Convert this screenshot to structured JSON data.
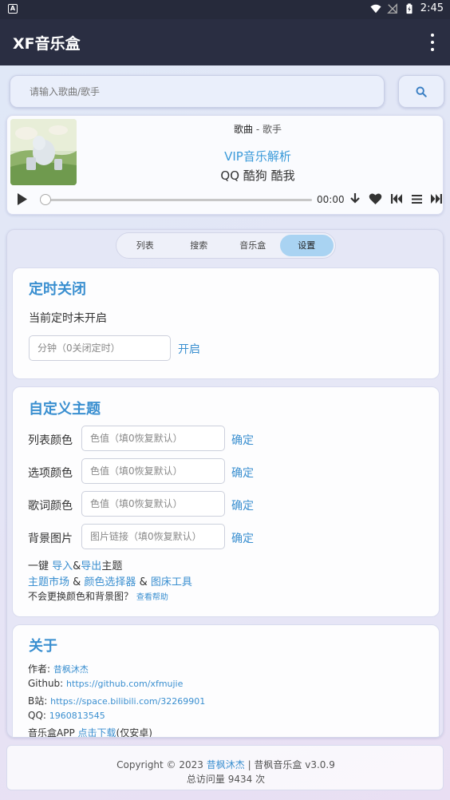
{
  "status_bar": {
    "time": "2:45",
    "left_icon": "A"
  },
  "app_bar": {
    "title": "XF音乐盒"
  },
  "search": {
    "placeholder": "请输入歌曲/歌手"
  },
  "player": {
    "song": "歌曲",
    "separator": " - ",
    "artist": "歌手",
    "vip_text": "VIP音乐解析",
    "sources": "QQ 酷狗 酷我",
    "time": "00:00",
    "progress": 0
  },
  "tabs": [
    {
      "label": "列表",
      "active": false
    },
    {
      "label": "搜索",
      "active": false
    },
    {
      "label": "音乐盒",
      "active": false
    },
    {
      "label": "设置",
      "active": true
    }
  ],
  "timer": {
    "title": "定时关闭",
    "status": "当前定时未开启",
    "placeholder": "分钟（0关闭定时）",
    "button": "开启"
  },
  "theme": {
    "title": "自定义主题",
    "rows": [
      {
        "label": "列表颜色",
        "placeholder": "色值（填0恢复默认）",
        "button": "确定"
      },
      {
        "label": "选项颜色",
        "placeholder": "色值（填0恢复默认）",
        "button": "确定"
      },
      {
        "label": "歌词颜色",
        "placeholder": "色值（填0恢复默认）",
        "button": "确定"
      },
      {
        "label": "背景图片",
        "placeholder": "图片链接（填0恢复默认）",
        "button": "确定"
      }
    ],
    "io_prefix": "一键 ",
    "import": "导入",
    "amp": "&",
    "export": "导出",
    "io_suffix": "主题",
    "market": "主题市场",
    "amp2": " & ",
    "color_picker": "颜色选择器",
    "amp3": " & ",
    "image_host": "图床工具",
    "help_q": "不会更换颜色和背景图？",
    "help_link": "查看帮助"
  },
  "about": {
    "title": "关于",
    "author_label": "作者: ",
    "author": "昔枫沐杰",
    "github_label": "Github: ",
    "github": "https://github.com/xfmujie",
    "bili_label": "B站: ",
    "bili": "https://space.bilibili.com/32269901",
    "qq_label": "QQ: ",
    "qq": "1960813545",
    "app_label": "音乐盒APP ",
    "app_link": "点击下载",
    "app_suffix": "(仅安卓)"
  },
  "footer": {
    "copyright_prefix": "Copyright © 2023 ",
    "author_link": "昔枫沐杰",
    "copyright_suffix": " | 昔枫音乐盒 v3.0.9",
    "visits": "总访问量 9434 次"
  },
  "colors": {
    "accent": "#3a8fd0",
    "appbar": "#2a2e42",
    "tab_active": "#a9d3f2"
  }
}
